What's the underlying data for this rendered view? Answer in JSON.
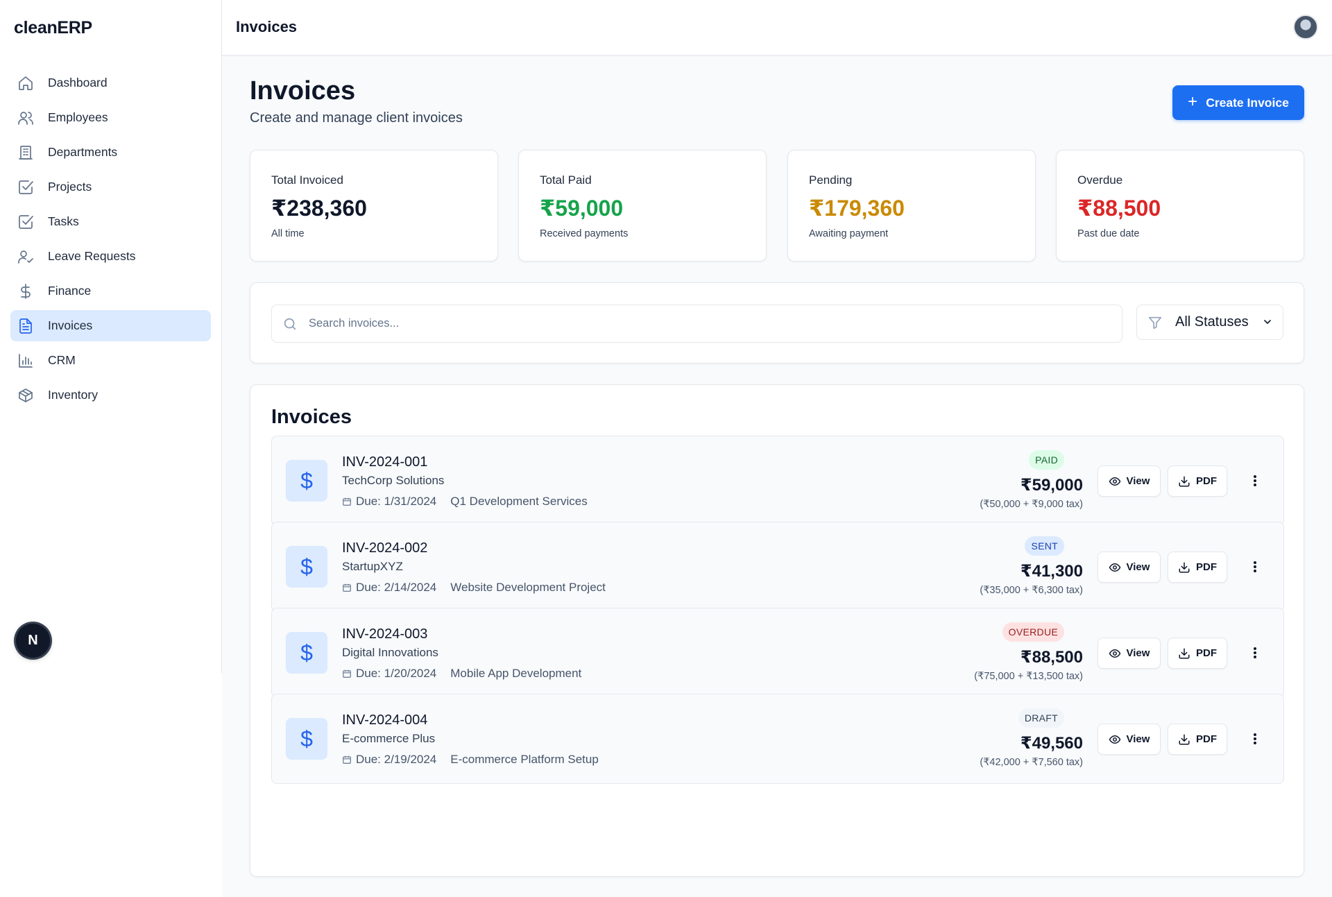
{
  "app": {
    "brand": "cleanERP",
    "topbar_title": "Invoices"
  },
  "sidebar": {
    "items": [
      {
        "label": "Dashboard",
        "icon": "home-icon",
        "active": false
      },
      {
        "label": "Employees",
        "icon": "users-icon",
        "active": false
      },
      {
        "label": "Departments",
        "icon": "building-icon",
        "active": false
      },
      {
        "label": "Projects",
        "icon": "check-square-icon",
        "active": false
      },
      {
        "label": "Tasks",
        "icon": "check-square-icon",
        "active": false
      },
      {
        "label": "Leave Requests",
        "icon": "user-check-icon",
        "active": false
      },
      {
        "label": "Finance",
        "icon": "dollar-icon",
        "active": false
      },
      {
        "label": "Invoices",
        "icon": "file-text-icon",
        "active": true
      },
      {
        "label": "CRM",
        "icon": "bar-chart-icon",
        "active": false
      },
      {
        "label": "Inventory",
        "icon": "package-icon",
        "active": false
      }
    ],
    "badge_letter": "N"
  },
  "header": {
    "title": "Invoices",
    "subtitle": "Create and manage client invoices",
    "create_label": "Create Invoice"
  },
  "stats": [
    {
      "label": "Total Invoiced",
      "value": "₹238,360",
      "sub": "All time",
      "color": "#0f172a"
    },
    {
      "label": "Total Paid",
      "value": "₹59,000",
      "sub": "Received payments",
      "color": "#16a34a"
    },
    {
      "label": "Pending",
      "value": "₹179,360",
      "sub": "Awaiting payment",
      "color": "#ca8a04"
    },
    {
      "label": "Overdue",
      "value": "₹88,500",
      "sub": "Past due date",
      "color": "#dc2626"
    }
  ],
  "search": {
    "placeholder": "Search invoices...",
    "value": ""
  },
  "filter": {
    "selected": "All Statuses"
  },
  "list": {
    "title": "Invoices",
    "view_label": "View",
    "pdf_label": "PDF",
    "invoices": [
      {
        "number": "INV-2024-001",
        "client": "TechCorp Solutions",
        "due": "Due: 1/31/2024",
        "description": "Q1 Development Services",
        "status": "PAID",
        "amount": "₹59,000",
        "breakdown": "(₹50,000 + ₹9,000 tax)"
      },
      {
        "number": "INV-2024-002",
        "client": "StartupXYZ",
        "due": "Due: 2/14/2024",
        "description": "Website Development Project",
        "status": "SENT",
        "amount": "₹41,300",
        "breakdown": "(₹35,000 + ₹6,300 tax)"
      },
      {
        "number": "INV-2024-003",
        "client": "Digital Innovations",
        "due": "Due: 1/20/2024",
        "description": "Mobile App Development",
        "status": "OVERDUE",
        "amount": "₹88,500",
        "breakdown": "(₹75,000 + ₹13,500 tax)"
      },
      {
        "number": "INV-2024-004",
        "client": "E-commerce Plus",
        "due": "Due: 2/19/2024",
        "description": "E-commerce Platform Setup",
        "status": "DRAFT",
        "amount": "₹49,560",
        "breakdown": "(₹42,000 + ₹7,560 tax)"
      }
    ]
  },
  "status_colors": {
    "PAID": {
      "bg": "#dcfce7",
      "fg": "#166534"
    },
    "SENT": {
      "bg": "#dbeafe",
      "fg": "#1e40af"
    },
    "OVERDUE": {
      "bg": "#fee2e2",
      "fg": "#991b1b"
    },
    "DRAFT": {
      "bg": "#f1f5f9",
      "fg": "#334155"
    }
  }
}
